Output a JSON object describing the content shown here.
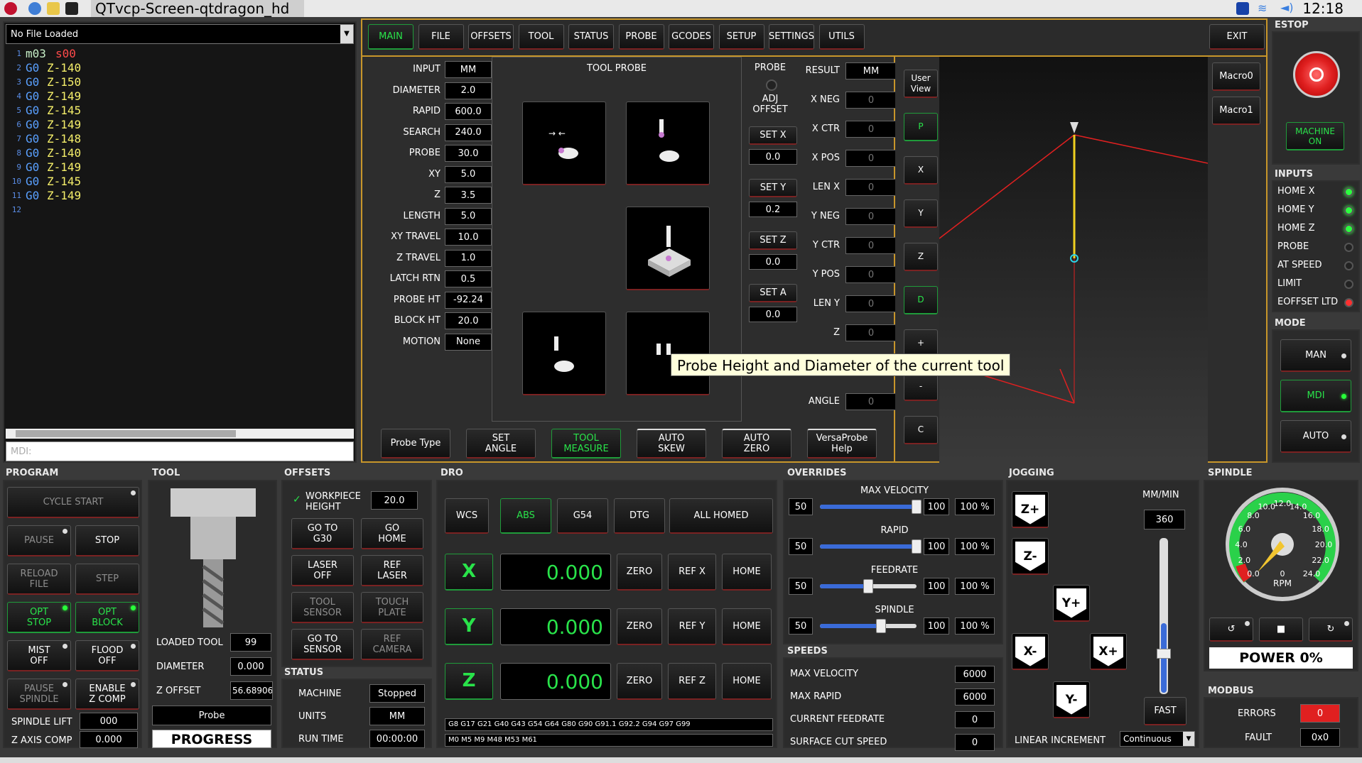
{
  "taskbar": {
    "window_title": "QTvcp-Screen-qtdragon_hd",
    "clock": "12:18"
  },
  "gcode": {
    "file": "No File Loaded",
    "mdi_placeholder": "MDI:",
    "lines": [
      {
        "n": "1",
        "a": "m03",
        "b": "s00"
      },
      {
        "n": "2",
        "a": "G0",
        "b": "Z-140"
      },
      {
        "n": "3",
        "a": "G0",
        "b": "Z-150"
      },
      {
        "n": "4",
        "a": "G0",
        "b": "Z-149"
      },
      {
        "n": "5",
        "a": "G0",
        "b": "Z-145"
      },
      {
        "n": "6",
        "a": "G0",
        "b": "Z-149"
      },
      {
        "n": "7",
        "a": "G0",
        "b": "Z-148"
      },
      {
        "n": "8",
        "a": "G0",
        "b": "Z-140"
      },
      {
        "n": "9",
        "a": "G0",
        "b": "Z-149"
      },
      {
        "n": "10",
        "a": "G0",
        "b": "Z-145"
      },
      {
        "n": "11",
        "a": "G0",
        "b": "Z-149"
      },
      {
        "n": "12",
        "a": "",
        "b": ""
      }
    ]
  },
  "tabs": [
    "MAIN",
    "FILE",
    "OFFSETS",
    "TOOL",
    "STATUS",
    "PROBE",
    "GCODES",
    "SETUP",
    "SETTINGS",
    "UTILS"
  ],
  "exit": "EXIT",
  "probe_params": [
    {
      "k": "INPUT",
      "v": "MM"
    },
    {
      "k": "DIAMETER",
      "v": "2.0"
    },
    {
      "k": "RAPID",
      "v": "600.0"
    },
    {
      "k": "SEARCH",
      "v": "240.0"
    },
    {
      "k": "PROBE",
      "v": "30.0"
    },
    {
      "k": "XY",
      "v": "5.0"
    },
    {
      "k": "Z",
      "v": "3.5"
    },
    {
      "k": "LENGTH",
      "v": "5.0"
    },
    {
      "k": "XY TRAVEL",
      "v": "10.0"
    },
    {
      "k": "Z TRAVEL",
      "v": "1.0"
    },
    {
      "k": "LATCH RTN",
      "v": "0.5"
    },
    {
      "k": "PROBE HT",
      "v": "-92.24"
    },
    {
      "k": "BLOCK HT",
      "v": "20.0"
    },
    {
      "k": "MOTION",
      "v": "None"
    }
  ],
  "tool_probe": {
    "title": "TOOL PROBE",
    "probe_label": "PROBE",
    "adj_offset": "ADJ\nOFFSET",
    "sets": [
      {
        "b": "SET X",
        "v": "0.0"
      },
      {
        "b": "SET Y",
        "v": "0.2"
      },
      {
        "b": "SET Z",
        "v": "0.0"
      },
      {
        "b": "SET A",
        "v": "0.0"
      }
    ],
    "tooltip": "Probe Height and Diameter of the current tool"
  },
  "results": [
    {
      "k": "RESULT",
      "v": "MM"
    },
    {
      "k": "X NEG",
      "v": "0"
    },
    {
      "k": "X CTR",
      "v": "0"
    },
    {
      "k": "X POS",
      "v": "0"
    },
    {
      "k": "LEN X",
      "v": "0"
    },
    {
      "k": "Y NEG",
      "v": "0"
    },
    {
      "k": "Y CTR",
      "v": "0"
    },
    {
      "k": "Y POS",
      "v": "0"
    },
    {
      "k": "LEN Y",
      "v": "0"
    },
    {
      "k": "Z",
      "v": "0"
    },
    {
      "k": "ANGLE",
      "v": "0"
    }
  ],
  "probe_bottom": [
    "Probe Type",
    "SET\nANGLE",
    "TOOL\nMEASURE",
    "AUTO\nSKEW",
    "AUTO\nZERO",
    "VersaProbe\nHelp"
  ],
  "view_buttons": [
    "User\nView",
    "P",
    "X",
    "Y",
    "Z",
    "D",
    "+",
    "-",
    "C"
  ],
  "macros": [
    "Macro0",
    "Macro1"
  ],
  "estop": {
    "label": "ESTOP",
    "machine_on": "MACHINE\nON"
  },
  "inputs": {
    "label": "INPUTS",
    "items": [
      {
        "k": "HOME X",
        "s": "g"
      },
      {
        "k": "HOME Y",
        "s": "g"
      },
      {
        "k": "HOME Z",
        "s": "g"
      },
      {
        "k": "PROBE",
        "s": "o"
      },
      {
        "k": "AT SPEED",
        "s": "o"
      },
      {
        "k": "LIMIT",
        "s": "o"
      },
      {
        "k": "EOFFSET LTD",
        "s": "r"
      }
    ]
  },
  "mode": {
    "label": "MODE",
    "items": [
      "MAN",
      "MDI",
      "AUTO"
    ]
  },
  "program": {
    "label": "PROGRAM",
    "cycle_start": "CYCLE START",
    "pause": "PAUSE",
    "stop": "STOP",
    "reload": "RELOAD\nFILE",
    "step": "STEP",
    "opt_stop": "OPT\nSTOP",
    "opt_block": "OPT\nBLOCK",
    "mist": "MIST\nOFF",
    "flood": "FLOOD\nOFF",
    "pause_spindle": "PAUSE\nSPINDLE",
    "enable_zcomp": "ENABLE\nZ COMP",
    "spindle_lift": "SPINDLE LIFT",
    "spindle_lift_v": "000",
    "z_axis_comp": "Z AXIS COMP",
    "z_axis_comp_v": "0.000"
  },
  "tool": {
    "label": "TOOL",
    "loaded_tool": "LOADED TOOL",
    "loaded_tool_v": "99",
    "diameter": "DIAMETER",
    "diameter_v": "0.000",
    "z_offset": "Z OFFSET",
    "z_offset_v": "56.689063",
    "probe": "Probe",
    "progress": "PROGRESS"
  },
  "offsets": {
    "label": "OFFSETS",
    "workpiece": "WORKPIECE\nHEIGHT",
    "workpiece_v": "20.0",
    "goto_g30": "GO TO\nG30",
    "go_home": "GO\nHOME",
    "laser_off": "LASER\nOFF",
    "ref_laser": "REF\nLASER",
    "tool_sensor": "TOOL\nSENSOR",
    "touch_plate": "TOUCH\nPLATE",
    "goto_sensor": "GO TO\nSENSOR",
    "ref_camera": "REF\nCAMERA"
  },
  "status": {
    "label": "STATUS",
    "rows": [
      {
        "k": "MACHINE",
        "v": "Stopped"
      },
      {
        "k": "UNITS",
        "v": "MM"
      },
      {
        "k": "RUN TIME",
        "v": "00:00:00"
      }
    ]
  },
  "dro": {
    "label": "DRO",
    "wcs": "WCS",
    "abs": "ABS",
    "g54": "G54",
    "dtg": "DTG",
    "all_homed": "ALL HOMED",
    "axes": [
      {
        "a": "X",
        "v": "0.000",
        "ref": "REF X"
      },
      {
        "a": "Y",
        "v": "0.000",
        "ref": "REF Y"
      },
      {
        "a": "Z",
        "v": "0.000",
        "ref": "REF Z"
      }
    ],
    "zero": "ZERO",
    "home": "HOME",
    "gcodes": "G8 G17 G21 G40 G43 G54 G64 G80 G90 G91.1 G92.2 G94 G97 G99",
    "mcodes": "M0 M5 M9 M48 M53 M61"
  },
  "overrides": {
    "label": "OVERRIDES",
    "items": [
      {
        "k": "MAX VELOCITY",
        "min": "50",
        "max": "100",
        "pct": "100 %",
        "pos": 1.0
      },
      {
        "k": "RAPID",
        "min": "50",
        "max": "100",
        "pct": "100 %",
        "pos": 1.0
      },
      {
        "k": "FEEDRATE",
        "min": "50",
        "max": "100",
        "pct": "100 %",
        "pos": 0.5
      },
      {
        "k": "SPINDLE",
        "min": "50",
        "max": "100",
        "pct": "100 %",
        "pos": 0.63
      }
    ]
  },
  "speeds": {
    "label": "SPEEDS",
    "rows": [
      {
        "k": "MAX VELOCITY",
        "v": "6000"
      },
      {
        "k": "MAX RAPID",
        "v": "6000"
      },
      {
        "k": "CURRENT FEEDRATE",
        "v": "0"
      },
      {
        "k": "SURFACE CUT SPEED",
        "v": "0"
      }
    ]
  },
  "jogging": {
    "label": "JOGGING",
    "units": "MM/MIN",
    "rate": "360",
    "fast": "FAST",
    "linear_inc": "LINEAR INCREMENT",
    "inc_v": "Continuous",
    "zp": "Z+",
    "zm": "Z-",
    "yp": "Y+",
    "ym": "Y-",
    "xp": "X+",
    "xm": "X-"
  },
  "spindle": {
    "label": "SPINDLE",
    "power": "POWER 0%",
    "rpm": "RPM",
    "zero": "0",
    "ticks": [
      "0.0",
      "2.0",
      "4.0",
      "6.0",
      "8.0",
      "10.0",
      "12.0",
      "14.0",
      "16.0",
      "18.0",
      "20.0",
      "22.0",
      "24.0"
    ]
  },
  "modbus": {
    "label": "MODBUS",
    "errors": "ERRORS",
    "errors_v": "0",
    "fault": "FAULT",
    "fault_v": "0x0"
  },
  "colors": {
    "accent_green": "#29e34a",
    "warn_red": "#7a2222",
    "probe_blue": "#3a6bd8"
  }
}
